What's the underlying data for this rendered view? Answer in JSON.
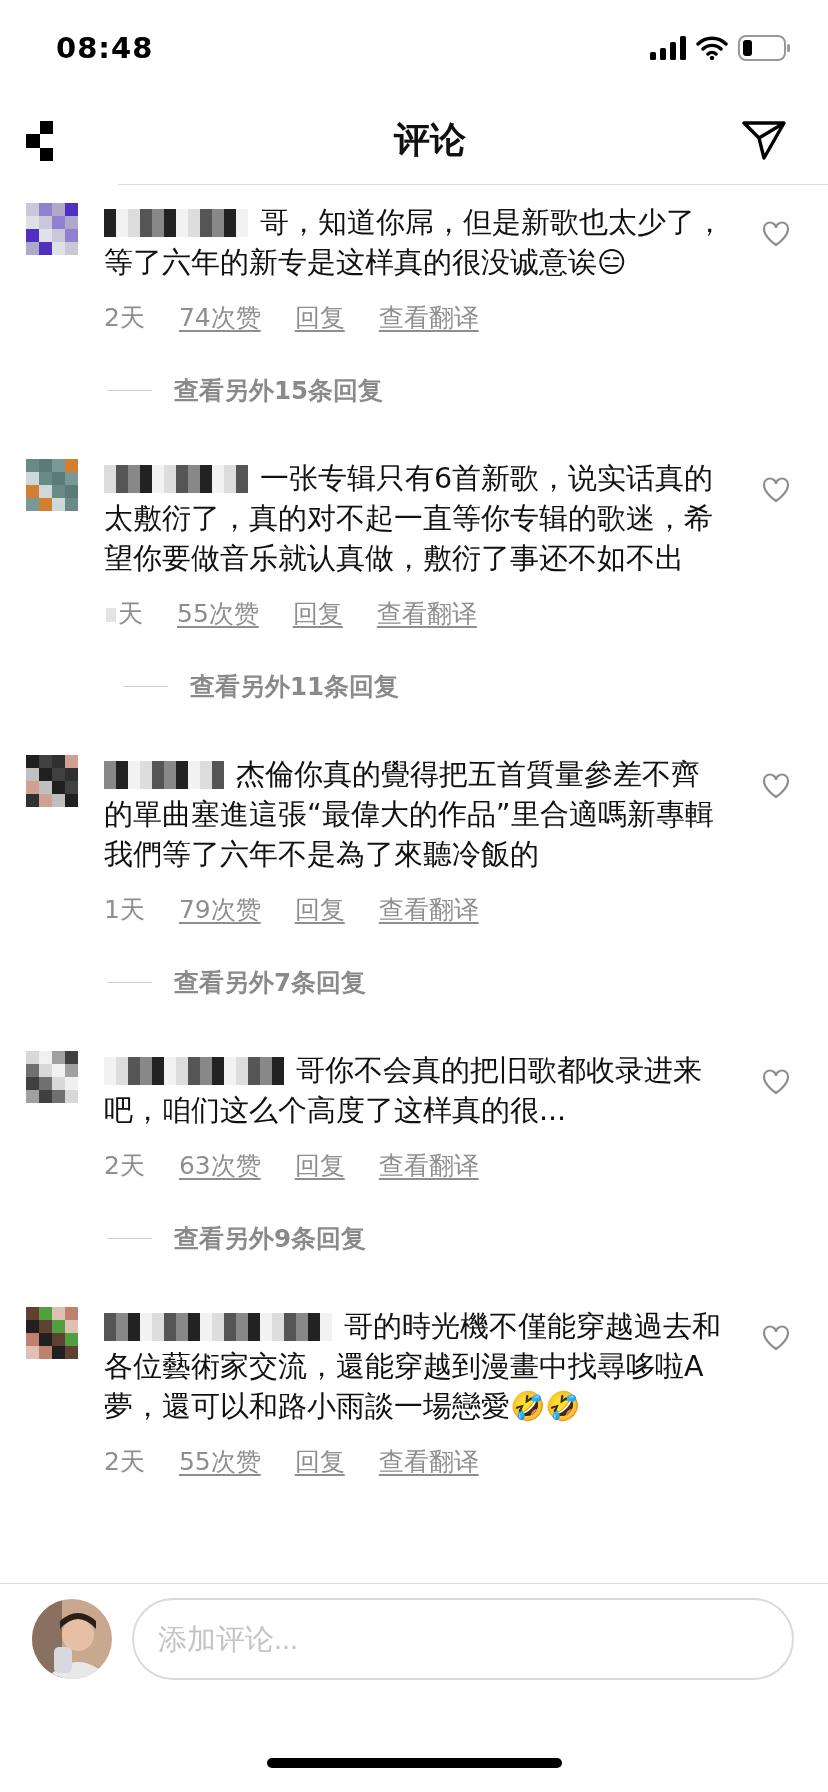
{
  "status_bar": {
    "time": "08:48"
  },
  "header": {
    "title": "评论"
  },
  "comments": [
    {
      "time": "2天",
      "time_masked": false,
      "likes": "74次赞",
      "reply": "回复",
      "translate": "查看翻译",
      "text": "哥，知道你屌，但是新歌也太少了，等了六年的新专是这样真的很没诚意诶😑",
      "more_replies": "查看另外15条回复",
      "liked": false
    },
    {
      "time": "天",
      "time_masked": true,
      "likes": "55次赞",
      "reply": "回复",
      "translate": "查看翻译",
      "text": "一张专辑只有6首新歌，说实话真的太敷衍了，真的对不起一直等你专辑的歌迷，希望你要做音乐就认真做，敷衍了事还不如不出",
      "more_replies": "查看另外11条回复",
      "liked": false
    },
    {
      "time": "1天",
      "time_masked": false,
      "likes": "79次赞",
      "reply": "回复",
      "translate": "查看翻译",
      "text": "杰倫你真的覺得把五首質量參差不齊的單曲塞進這張“最偉大的作品”里合適嗎新專輯我們等了六年不是為了來聽冷飯的",
      "more_replies": "查看另外7条回复",
      "liked": false
    },
    {
      "time": "2天",
      "time_masked": false,
      "likes": "63次赞",
      "reply": "回复",
      "translate": "查看翻译",
      "text": "哥你不会真的把旧歌都收录进来吧，咱们这么个高度了这样真的很...",
      "more_replies": "查看另外9条回复",
      "liked": false
    },
    {
      "time": "2天",
      "time_masked": false,
      "likes": "55次赞",
      "reply": "回复",
      "translate": "查看翻译",
      "text": "哥的時光機不僅能穿越過去和各位藝術家交流，還能穿越到漫畫中找尋哆啦A夢，還可以和路小雨談一場戀愛🤣🤣",
      "liked": false
    }
  ],
  "composer": {
    "placeholder": "添加评论..."
  }
}
